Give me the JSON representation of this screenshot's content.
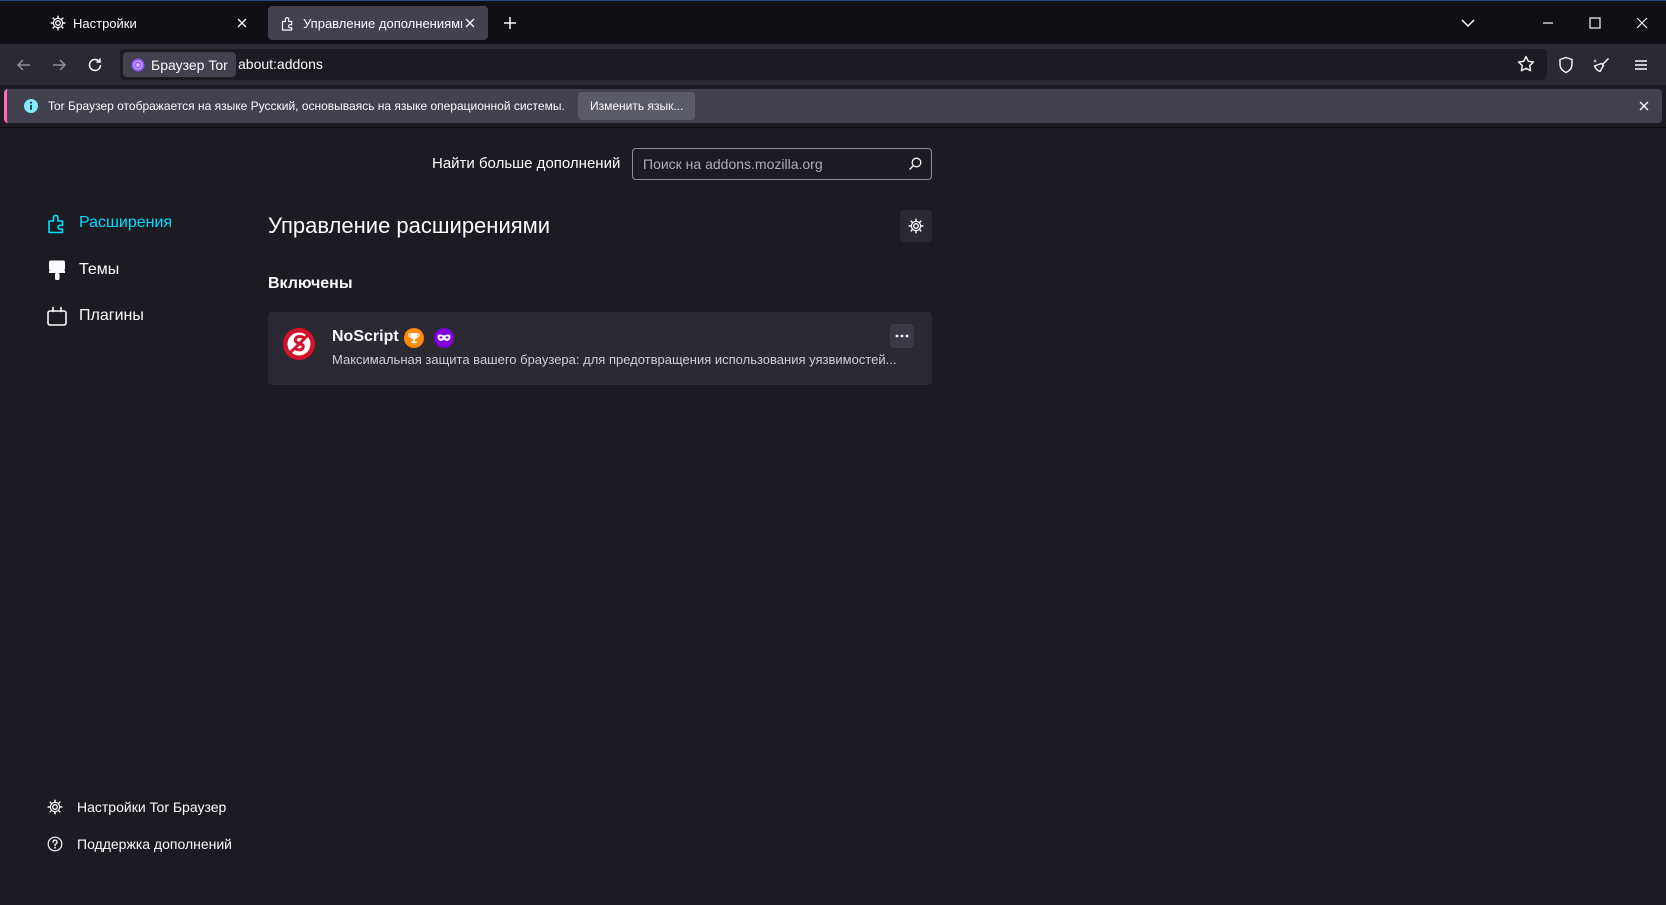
{
  "tabs": [
    {
      "label": "Настройки",
      "icon": "gear-icon"
    },
    {
      "label": "Управление дополнениями",
      "icon": "puzzle-icon"
    }
  ],
  "url_bar": {
    "identity_label": "Браузер Tor",
    "url": "about:addons"
  },
  "infobar": {
    "message": "Tor Браузер отображается на языке Русский, основываясь на языке операционной системы.",
    "button_label": "Изменить язык..."
  },
  "search": {
    "label": "Найти больше дополнений",
    "placeholder": "Поиск на addons.mozilla.org"
  },
  "sidebar": {
    "categories": [
      {
        "label": "Расширения",
        "icon": "puzzle-icon",
        "active": true
      },
      {
        "label": "Темы",
        "icon": "brush-icon",
        "active": false
      },
      {
        "label": "Плагины",
        "icon": "plugin-icon",
        "active": false
      }
    ],
    "footer": [
      {
        "label": "Настройки Tor Браузер",
        "icon": "gear-icon"
      },
      {
        "label": "Поддержка дополнений",
        "icon": "help-icon"
      }
    ]
  },
  "main": {
    "heading": "Управление расширениями",
    "section_enabled": "Включены",
    "extensions": [
      {
        "name": "NoScript",
        "description": "Максимальная защита вашего браузера: для предотвращения использования уязвимостей...",
        "badges": [
          "recommended-trophy-icon",
          "private-browsing-mask-icon"
        ]
      }
    ]
  },
  "colors": {
    "accent": "#00ddff",
    "background": "#1c1b22",
    "infobar_border": "#ff6bba"
  }
}
